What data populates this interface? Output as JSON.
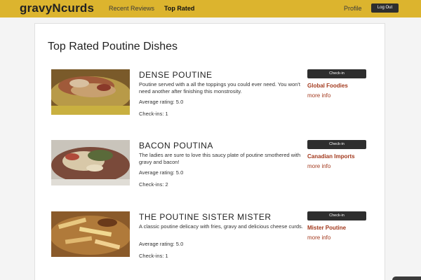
{
  "header": {
    "brand": "gravyNcurds",
    "nav": {
      "recent_reviews": "Recent Reviews",
      "top_rated": "Top Rated"
    },
    "profile": "Profile",
    "logout": "Log Out"
  },
  "main": {
    "title": "Top Rated Poutine Dishes",
    "dishes": [
      {
        "name": "DENSE POUTINE",
        "description": "Poutine served with a all the toppings you could ever need. You won't need another after finishing this monstrosity.",
        "rating": "Average rating: 5.0",
        "checkins": "Check-ins: 1",
        "checkin_label": "Check-in",
        "vendor": "Global Foodies",
        "more_info": "more info"
      },
      {
        "name": "BACON POUTINA",
        "description": "The ladies are sure to love this saucy plate of poutine smothered with gravy and bacon!",
        "rating": "Average rating: 5.0",
        "checkins": "Check-ins: 2",
        "checkin_label": "Check-in",
        "vendor": "Canadian Imports",
        "more_info": "more info"
      },
      {
        "name": "THE POUTINE SISTER MISTER",
        "description": "A classic poutine delicacy with fries, gravy and delicious cheese curds.",
        "rating": "Average rating: 5.0",
        "checkins": "Check-ins: 1",
        "checkin_label": "Check-in",
        "vendor": "Mister Poutine",
        "more_info": "more info"
      }
    ]
  },
  "colors": {
    "header_bg": "#dcb42e",
    "link": "#a33a1e",
    "button": "#2e2e2e"
  }
}
